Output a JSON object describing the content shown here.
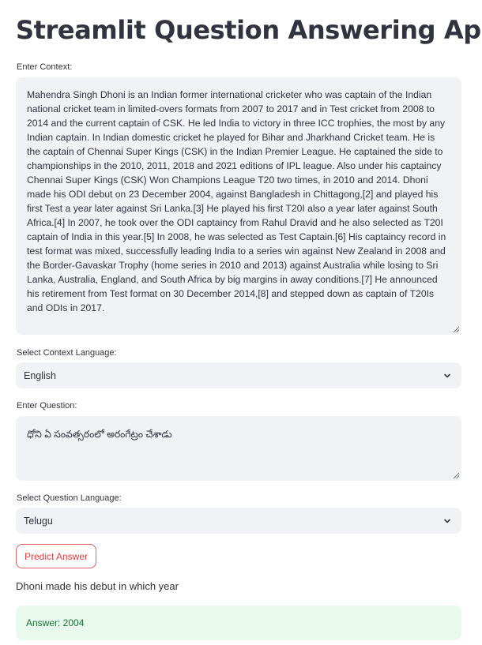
{
  "app": {
    "title": "Streamlit Question Answering App"
  },
  "context": {
    "label": "Enter Context:",
    "value": "Mahendra Singh Dhoni is an Indian former international cricketer who was captain of the Indian national cricket team in limited-overs formats from 2007 to 2017 and in Test cricket from 2008 to 2014 and the current captain of CSK. He led India to victory in three ICC trophies, the most by any Indian captain. In Indian domestic cricket he played for Bihar and Jharkhand Cricket team. He is the captain of Chennai Super Kings (CSK) in the Indian Premier League. He captained the side to championships in the 2010, 2011, 2018 and 2021 editions of IPL league. Also under his captaincy Chennai Super Kings (CSK) Won Champions League T20 two times, in 2010 and 2014. Dhoni made his ODI debut on 23 December 2004, against Bangladesh in Chittagong,[2] and played his first Test a year later against Sri Lanka.[3] He played his first T20I also a year later against South Africa.[4] In 2007, he took over the ODI captaincy from Rahul Dravid and he also selected as T20I captain of India in this year.[5] In 2008, he was selected as Test Captain.[6] His captaincy record in test format was mixed, successfully leading India to a series win against New Zealand in 2008 and the Border-Gavaskar Trophy (home series in 2010 and 2013) against Australia while losing to Sri Lanka, Australia, England, and South Africa by big margins in away conditions.[7] He announced his retirement from Test format on 30 December 2014,[8] and stepped down as captain of T20Is and ODIs in 2017."
  },
  "context_language": {
    "label": "Select Context Language:",
    "selected": "English"
  },
  "question": {
    "label": "Enter Question:",
    "value": "ధోని ఏ సంవత్సరంలో అరంగేట్రం చేశాడు"
  },
  "question_language": {
    "label": "Select Question Language:",
    "selected": "Telugu"
  },
  "predict_button": {
    "label": "Predict Answer"
  },
  "result": {
    "translated_question": "Dhoni made his debut in which year",
    "answer": "Answer: 2004"
  },
  "icons": {
    "select_arrow": "chevron-down-icon",
    "resize_handle": "resize-grip-icon"
  },
  "colors": {
    "input_bg": "#f0f2f6",
    "button_accent": "#e0403f",
    "success_bg": "#e9f9ee",
    "success_text": "#177233"
  }
}
